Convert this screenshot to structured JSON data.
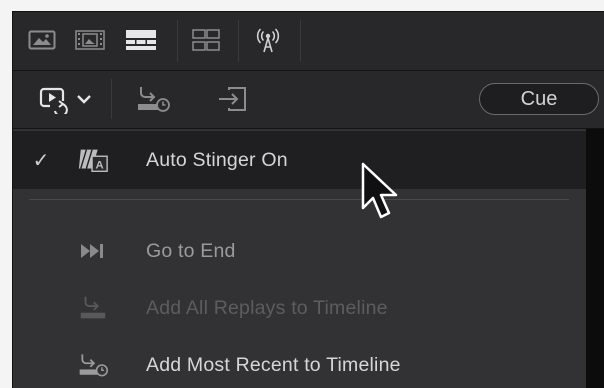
{
  "toolbar_views": {
    "icons": [
      "single-viewer-icon",
      "filmstrip-viewer-icon",
      "timeline-view-icon",
      "grid-layout-icon",
      "broadcast-icon"
    ]
  },
  "toolbar_actions": {
    "cue_label": "Cue"
  },
  "menu": {
    "items": [
      {
        "label": "Auto Stinger On",
        "checked": true,
        "state": "active",
        "icon": "auto-stinger-icon"
      },
      {
        "label": "Go to End",
        "checked": false,
        "state": "normal",
        "icon": "skip-to-end-icon"
      },
      {
        "label": "Add All Replays to Timeline",
        "checked": false,
        "state": "disabled",
        "icon": "add-all-replays-icon"
      },
      {
        "label": "Add Most Recent to Timeline",
        "checked": false,
        "state": "normal",
        "icon": "add-recent-icon"
      }
    ],
    "check_glyph": "✓"
  },
  "colors": {
    "window_bg": "#232325",
    "menu_bg": "#323234",
    "active_item_bg": "#1f1f21",
    "text": "#d6d6d8",
    "disabled_text": "#5d5d60"
  }
}
